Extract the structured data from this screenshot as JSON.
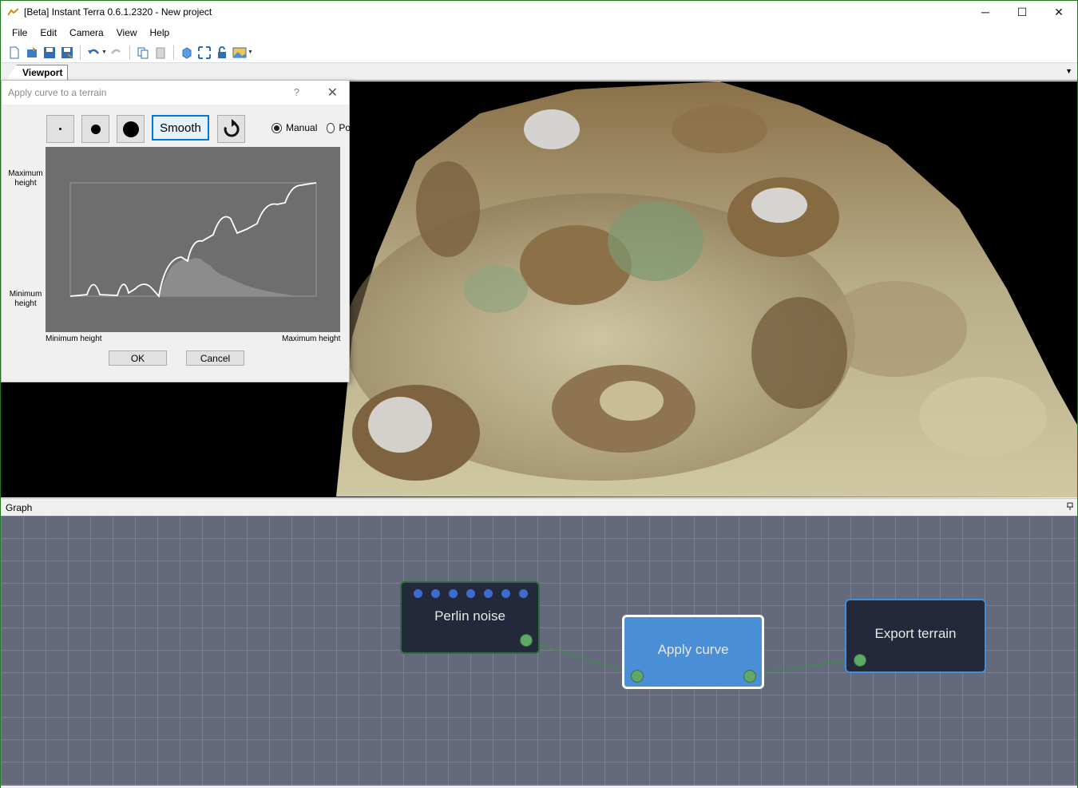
{
  "window": {
    "title": "[Beta] Instant Terra 0.6.1.2320 - New project",
    "minimize": "─",
    "maximize": "☐",
    "close": "✕"
  },
  "menu": [
    "File",
    "Edit",
    "Camera",
    "View",
    "Help"
  ],
  "toolbar": {
    "icons": [
      "new-icon",
      "open-icon",
      "save-icon",
      "save-as-icon",
      "undo-icon",
      "redo-icon",
      "copy-icon",
      "paste-icon",
      "cube-icon",
      "fit-icon",
      "lock-icon",
      "image-icon"
    ]
  },
  "viewport_tab": {
    "label": "Viewport",
    "dropdown": "▼"
  },
  "dialog": {
    "title": "Apply curve to a terrain",
    "help": "?",
    "close": "✕",
    "smooth_label": "Smooth",
    "radio_manual": "Manual",
    "radio_other": "Po",
    "y_max_label": "Maximum height",
    "y_min_label": "Minimum height",
    "x_min_label": "Minimum height",
    "x_max_label": "Maximum height",
    "ok_label": "OK",
    "cancel_label": "Cancel"
  },
  "graph": {
    "header": "Graph",
    "pin": "📌",
    "nodes": {
      "perlin": "Perlin noise",
      "apply_curve": "Apply curve",
      "export": "Export terrain"
    }
  },
  "colors": {
    "graph_bg": "#646a7c",
    "node_dark": "#23293a",
    "node_selected": "#4a8fd6",
    "port_green": "#5fa868",
    "accent": "#0078d7"
  }
}
